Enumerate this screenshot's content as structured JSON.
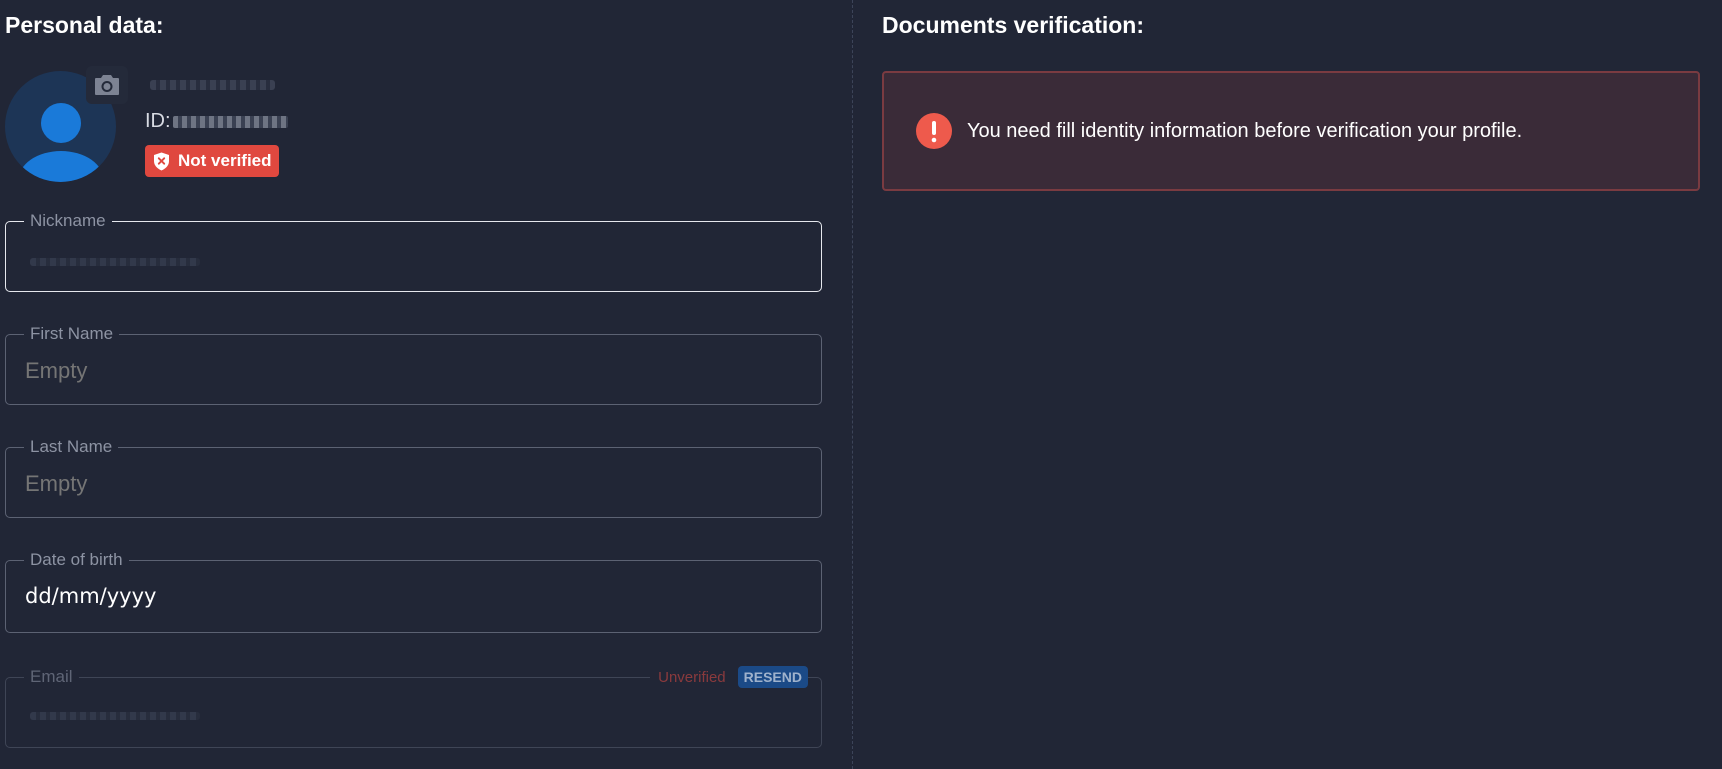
{
  "personal": {
    "title": "Personal data:",
    "id_prefix": "ID:",
    "status_badge": "Not verified",
    "fields": {
      "nickname": {
        "label": "Nickname",
        "value": ""
      },
      "first_name": {
        "label": "First Name",
        "placeholder": "Empty"
      },
      "last_name": {
        "label": "Last Name",
        "placeholder": "Empty"
      },
      "date_of_birth": {
        "label": "Date of birth",
        "value": "dd/mm/yyyy"
      },
      "email": {
        "label": "Email",
        "status": "Unverified",
        "resend_label": "RESEND"
      }
    }
  },
  "documents": {
    "title": "Documents verification:",
    "alert_message": "You need fill identity information before verification your profile."
  },
  "colors": {
    "background": "#212636",
    "badge_red": "#e0483f",
    "avatar_blue": "#1a7ad9",
    "alert_border": "#7a3b41",
    "resend_blue": "#1b4a87"
  },
  "icons": {
    "camera": "camera-icon",
    "status": "shield-x-icon",
    "alert": "exclamation-icon"
  }
}
